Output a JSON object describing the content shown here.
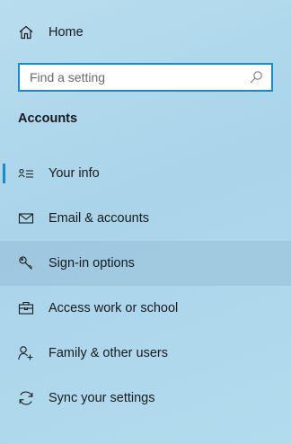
{
  "nav": {
    "home": {
      "label": "Home",
      "icon": "home-icon"
    },
    "search": {
      "placeholder": "Find a setting",
      "value": "",
      "icon": "search-icon"
    },
    "section": {
      "title": "Accounts"
    },
    "items": [
      {
        "id": "your-info",
        "label": "Your info",
        "icon": "person-list-icon",
        "selected": true
      },
      {
        "id": "email-accounts",
        "label": "Email & accounts",
        "icon": "mail-icon",
        "selected": false
      },
      {
        "id": "sign-in-options",
        "label": "Sign-in options",
        "icon": "key-icon",
        "selected": false,
        "hovered": true
      },
      {
        "id": "access-work-school",
        "label": "Access work or school",
        "icon": "briefcase-icon",
        "selected": false
      },
      {
        "id": "family-other-users",
        "label": "Family & other users",
        "icon": "person-add-icon",
        "selected": false
      },
      {
        "id": "sync-settings",
        "label": "Sync your settings",
        "icon": "sync-icon",
        "selected": false
      }
    ]
  },
  "colors": {
    "accent": "#1a8bc4",
    "background": "#b3dbee",
    "hover": "#9fc3d6",
    "text": "#1a1a1a"
  }
}
